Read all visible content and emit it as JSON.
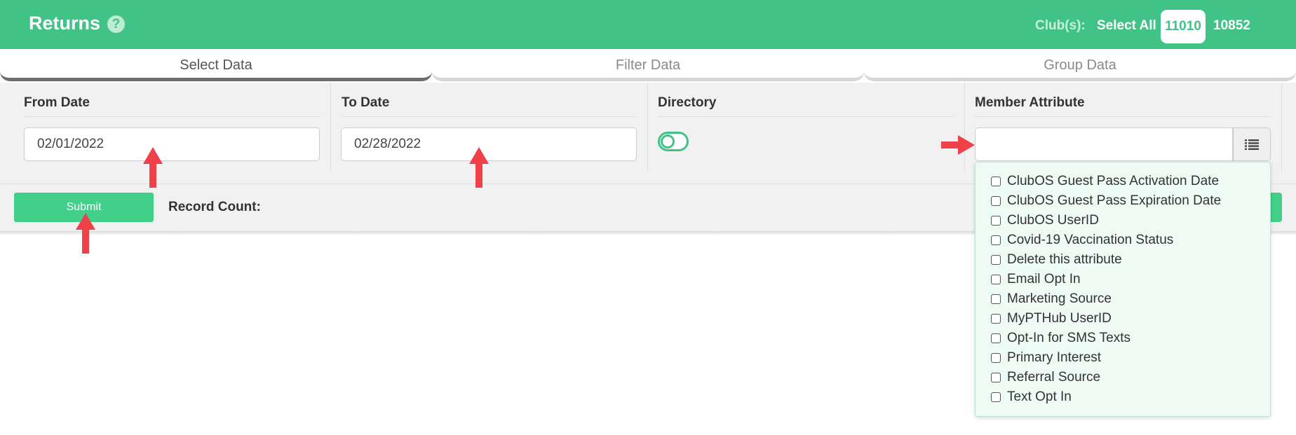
{
  "header": {
    "title": "Returns",
    "help_glyph": "?",
    "clubs_label": "Club(s):",
    "select_all": "Select All",
    "clubs": [
      "11010",
      "10852"
    ],
    "active_club": "11010"
  },
  "tabs": [
    {
      "label": "Select Data",
      "active": true
    },
    {
      "label": "Filter Data",
      "active": false
    },
    {
      "label": "Group Data",
      "active": false
    }
  ],
  "filters": {
    "from_date": {
      "label": "From Date",
      "value": "02/01/2022"
    },
    "to_date": {
      "label": "To Date",
      "value": "02/28/2022"
    },
    "directory": {
      "label": "Directory",
      "toggle_on": false
    },
    "member_attribute": {
      "label": "Member Attribute",
      "value": "",
      "list_icon": "list-icon"
    }
  },
  "actions": {
    "submit_label": "Submit",
    "record_count_label": "Record Count:"
  },
  "attribute_options": [
    "ClubOS Guest Pass Activation Date",
    "ClubOS Guest Pass Expiration Date",
    "ClubOS UserID",
    "Covid-19 Vaccination Status",
    "Delete this attribute",
    "Email Opt In",
    "Marketing Source",
    "MyPTHub UserID",
    "Opt-In for SMS Texts",
    "Primary Interest",
    "Referral Source",
    "Text Opt In"
  ],
  "colors": {
    "brand_green": "#41c387",
    "annotation_red": "#f0404a"
  }
}
